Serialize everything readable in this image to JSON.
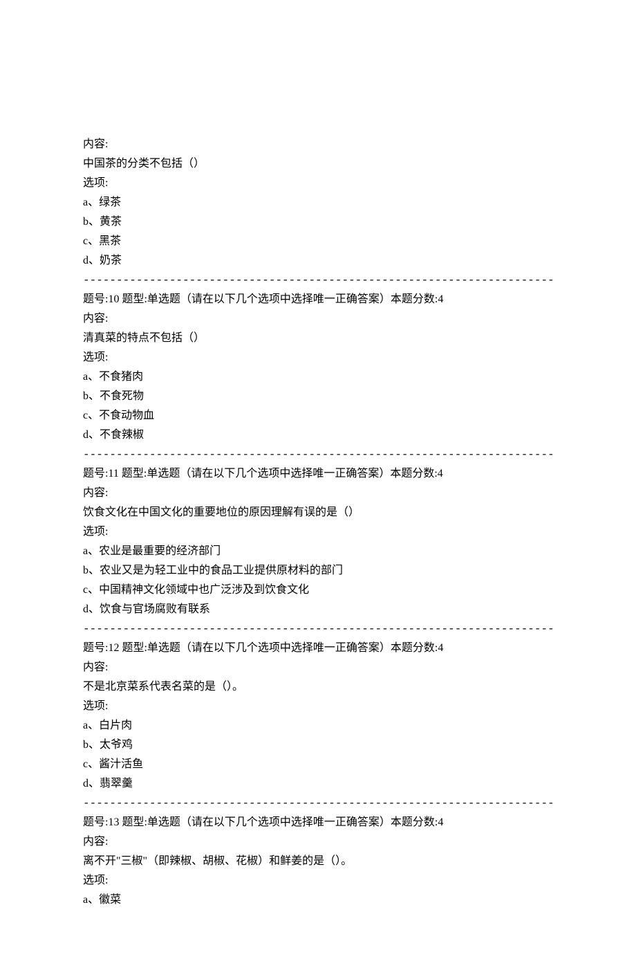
{
  "divider": "--------------------------------------------------------------------------------",
  "labels": {
    "content": "内容:",
    "options": "选项:",
    "qnum_prefix": "题号:",
    "qtype_prefix": " 题型:",
    "score_prefix": "本题分数:",
    "qtype": "单选题（请在以下几个选项中选择唯一正确答案）"
  },
  "partial_question": {
    "text": "中国茶的分类不包括（）",
    "options": [
      "a、绿茶",
      "b、黄茶",
      "c、黑茶",
      "d、奶茶"
    ]
  },
  "questions": [
    {
      "number": "10",
      "score": "4",
      "text": "清真菜的特点不包括（）",
      "options": [
        "a、不食猪肉",
        "b、不食死物",
        "c、不食动物血",
        "d、不食辣椒"
      ]
    },
    {
      "number": "11",
      "score": "4",
      "text": "饮食文化在中国文化的重要地位的原因理解有误的是（）",
      "options": [
        "a、农业是最重要的经济部门",
        "b、农业又是为轻工业中的食品工业提供原材料的部门",
        "c、中国精神文化领域中也广泛涉及到饮食文化",
        "d、饮食与官场腐败有联系"
      ]
    },
    {
      "number": "12",
      "score": "4",
      "text": "不是北京菜系代表名菜的是（）。",
      "options": [
        "a、白片肉",
        "b、太爷鸡",
        "c、酱汁活鱼",
        "d、翡翠羹"
      ]
    },
    {
      "number": "13",
      "score": "4",
      "text": "离不开\"三椒\"（即辣椒、胡椒、花椒）和鲜姜的是（）。",
      "options": [
        "a、徽菜"
      ]
    }
  ]
}
